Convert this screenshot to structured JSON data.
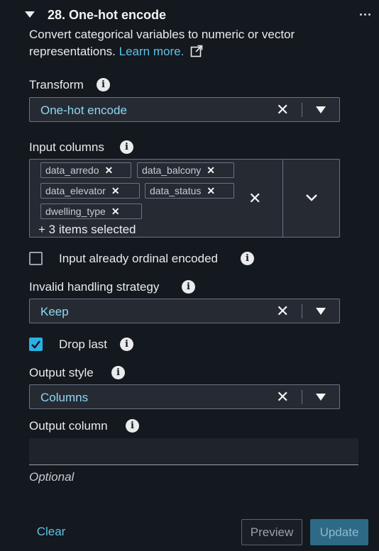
{
  "header": {
    "title": "28. One-hot encode"
  },
  "description": {
    "text": "Convert categorical variables to numeric or vector representations.",
    "link_text": "Learn more."
  },
  "transform": {
    "label": "Transform",
    "value": "One-hot encode"
  },
  "input_columns": {
    "label": "Input columns",
    "tokens": [
      "data_arredo",
      "data_balcony",
      "data_elevator",
      "data_status",
      "dwelling_type"
    ],
    "more_text": "+ 3 items selected"
  },
  "ordinal": {
    "label": "Input already ordinal encoded",
    "checked": false
  },
  "invalid_handling": {
    "label": "Invalid handling strategy",
    "value": "Keep"
  },
  "drop_last": {
    "label": "Drop last",
    "checked": true
  },
  "output_style": {
    "label": "Output style",
    "value": "Columns"
  },
  "output_column": {
    "label": "Output column",
    "value": "",
    "hint": "Optional"
  },
  "footer": {
    "clear_label": "Clear",
    "preview_label": "Preview",
    "update_label": "Update"
  },
  "colors": {
    "accent": "#29b1e6",
    "link": "#5dc3e8",
    "background": "#14181f"
  },
  "icons": [
    "caret-down-icon",
    "more-icon",
    "external-link-icon",
    "info-icon",
    "close-icon",
    "chevron-down-icon",
    "check-icon"
  ]
}
